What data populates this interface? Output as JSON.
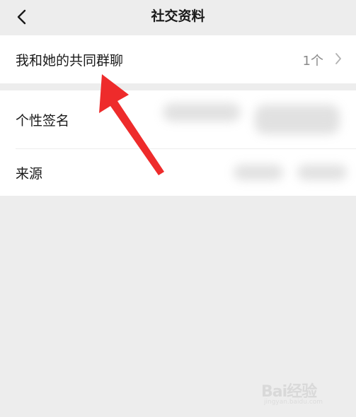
{
  "nav": {
    "title": "社交资料",
    "back_icon": "chevron-left-icon"
  },
  "common_groups": {
    "label": "我和她的共同群聊",
    "value": "1个",
    "chevron_icon": "chevron-right-icon"
  },
  "signature": {
    "label": "个性签名"
  },
  "source": {
    "label": "来源"
  },
  "annotation": {
    "arrow_color": "#ee2b2b",
    "arrow_icon": "red-arrow-annotation"
  },
  "watermark": {
    "text": "Bai经验",
    "sub": "jingyan.baidu.com"
  },
  "colors": {
    "background": "#ededed",
    "card": "#ffffff",
    "secondary_text": "#8a8a8a"
  }
}
